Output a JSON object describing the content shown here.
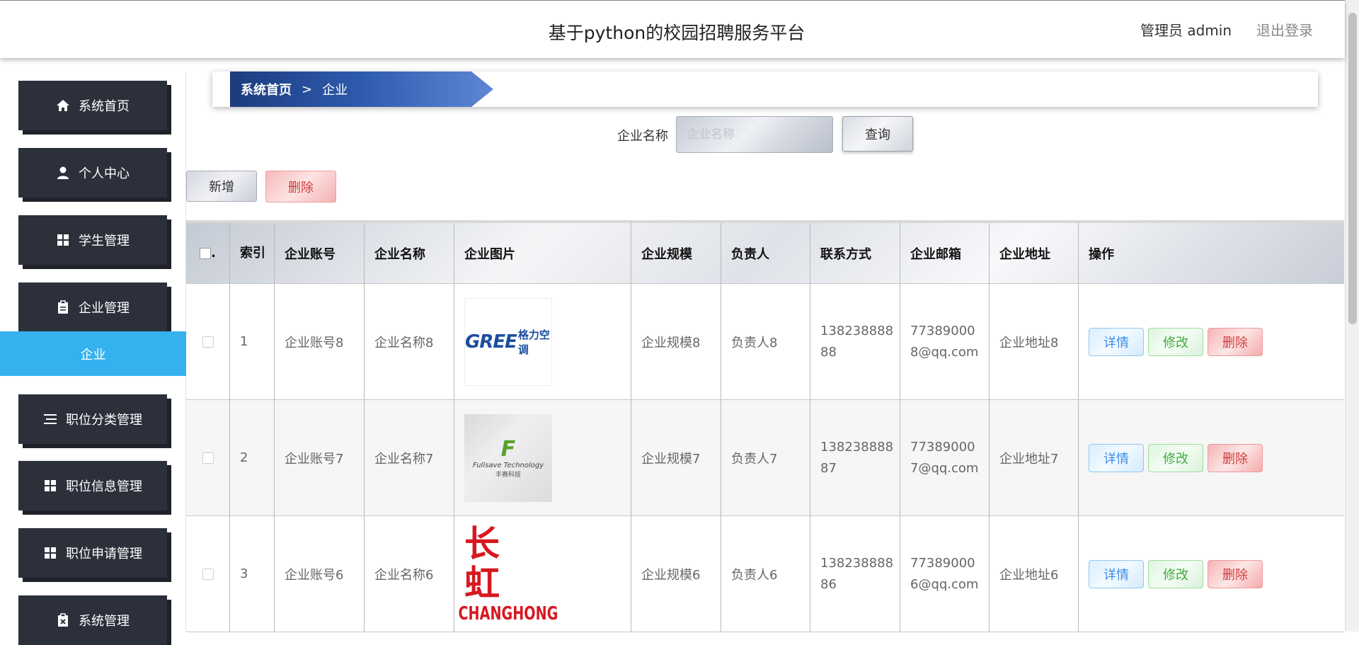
{
  "header": {
    "title": "基于python的校园招聘服务平台",
    "user": "管理员 admin",
    "logout": "退出登录"
  },
  "sidebar": {
    "items": [
      {
        "label": "系统首页",
        "icon": "home-icon"
      },
      {
        "label": "个人中心",
        "icon": "user-icon"
      },
      {
        "label": "学生管理",
        "icon": "grid-icon"
      },
      {
        "label": "企业管理",
        "icon": "clipboard-icon"
      },
      {
        "label": "职位分类管理",
        "icon": "list-icon"
      },
      {
        "label": "职位信息管理",
        "icon": "grid-icon"
      },
      {
        "label": "职位申请管理",
        "icon": "grid-icon"
      },
      {
        "label": "系统管理",
        "icon": "clipboard-x-icon"
      }
    ],
    "active_sub": "企业"
  },
  "breadcrumb": {
    "home": "系统首页",
    "separator": ">",
    "current": "企业"
  },
  "search": {
    "label": "企业名称",
    "placeholder": "企业名称",
    "value": "",
    "button": "查询"
  },
  "actions": {
    "add": "新增",
    "delete": "删除"
  },
  "table": {
    "columns": [
      "",
      "索引",
      "企业账号",
      "企业名称",
      "企业图片",
      "企业规模",
      "负责人",
      "联系方式",
      "企业邮箱",
      "企业地址",
      "操作"
    ],
    "rows": [
      {
        "index": "1",
        "account": "企业账号8",
        "name": "企业名称8",
        "logo": "GREE格力空调",
        "scale": "企业规模8",
        "owner": "负责人8",
        "phone": "13823888888",
        "email": "773890008@qq.com",
        "address": "企业地址8"
      },
      {
        "index": "2",
        "account": "企业账号7",
        "name": "企业名称7",
        "logo": "Fullsave Technology 丰赛科技",
        "scale": "企业规模7",
        "owner": "负责人7",
        "phone": "13823888887",
        "email": "773890007@qq.com",
        "address": "企业地址7"
      },
      {
        "index": "3",
        "account": "企业账号6",
        "name": "企业名称6",
        "logo": "长虹 CHANGHONG",
        "scale": "企业规模6",
        "owner": "负责人6",
        "phone": "13823888886",
        "email": "773890006@qq.com",
        "address": "企业地址6"
      }
    ],
    "ops": {
      "detail": "详情",
      "edit": "修改",
      "delete": "删除"
    }
  },
  "logos": {
    "gree_latin": "GREE",
    "gree_cn": "格力空调",
    "fullsave_mark": "F",
    "fullsave_en": "Fullsave Technology",
    "fullsave_cn": "丰赛科技",
    "changhong_cn": "长虹",
    "changhong_en": "CHANGHONG"
  },
  "colors": {
    "sidebar_bg": "#2b303b",
    "sidebar_active": "#36b1f0",
    "breadcrumb": "#1b3c7e"
  }
}
